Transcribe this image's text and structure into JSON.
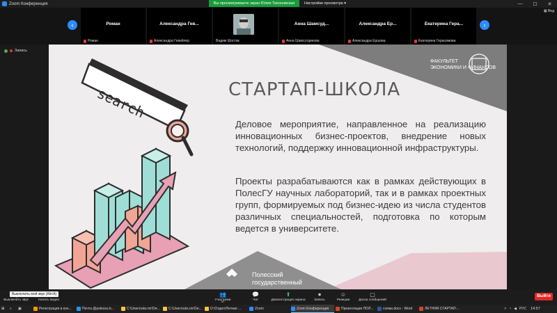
{
  "window": {
    "title": "Zoom Конференция",
    "share_banner": "Вы просматриваете экран Юлия Тихоновская",
    "view_settings": "Настройки просмотра",
    "view_button": "Вид"
  },
  "participants": [
    {
      "name": "Роман",
      "label": "Роман"
    },
    {
      "name": "Александра Гев...",
      "label": "Александра Гевейлер"
    },
    {
      "name": "",
      "label": "Вадим Шостак"
    },
    {
      "name": "Анна Шамсуд...",
      "label": "Анна Шамсутдинова"
    },
    {
      "name": "Александра Ер...",
      "label": "Александра Ершова"
    },
    {
      "name": "Екатерина Гера...",
      "label": "Екатерина Герасимова"
    }
  ],
  "recording": "Запись",
  "slide": {
    "title": "СТАРТАП-ШКОЛА",
    "search_word": "search",
    "paragraph1": "Деловое мероприятие, направленное на реализацию инновационных бизнес-проектов, внедрение новых технологий, поддержку инновационной инфраструктуры.",
    "paragraph2": "Проекты разрабатываются как в рамках действующих в ПолесГУ научных лабораторий, так и в рамках проектных групп, формируемых под бизнес-идею из числа студентов различных специальностей, подготовка по которым ведется в университете.",
    "faculty_line1": "ФАКУЛЬТЕТ",
    "faculty_line2": "ЭКОНОМИКИ И ФИНАНСОВ",
    "uni_line1": "Полесский",
    "uni_line2": "государственный"
  },
  "toolbar": {
    "mute": "Выключить звук",
    "video": "Начать видео",
    "participants": "Участники",
    "participants_count": "47",
    "chat": "Чат",
    "share": "Демонстрация экрана",
    "record": "Запись",
    "reactions": "Реакции",
    "whiteboard": "Доска сообщений",
    "leave": "Выйти",
    "tooltip": "Выключить мой звук (Alt+A)"
  },
  "taskbar": {
    "items": [
      "Регистрация в кон...",
      "Почта @polessu.b...",
      "C:\\Users\\uks.mr\\De...",
      "C:\\Users\\uks.mr\\De...",
      "D:\\Отдел\\Летние ...",
      "Zoom",
      "Zoom Конференция",
      "Презентация ПОЛ...",
      "схема.docx - Word",
      "ЛЕТНЯЯ СТАРТАП-..."
    ],
    "lang": "РУС",
    "time": "14:57"
  },
  "colors": {
    "accent": "#2d8cff",
    "share_green": "#1a9b3b",
    "leave_red": "#e02828",
    "slide_bg": "#efedee",
    "teal": "#9fded7",
    "salmon": "#f2a594",
    "pink": "#e8a0b4",
    "dark": "#2d2d2d"
  }
}
